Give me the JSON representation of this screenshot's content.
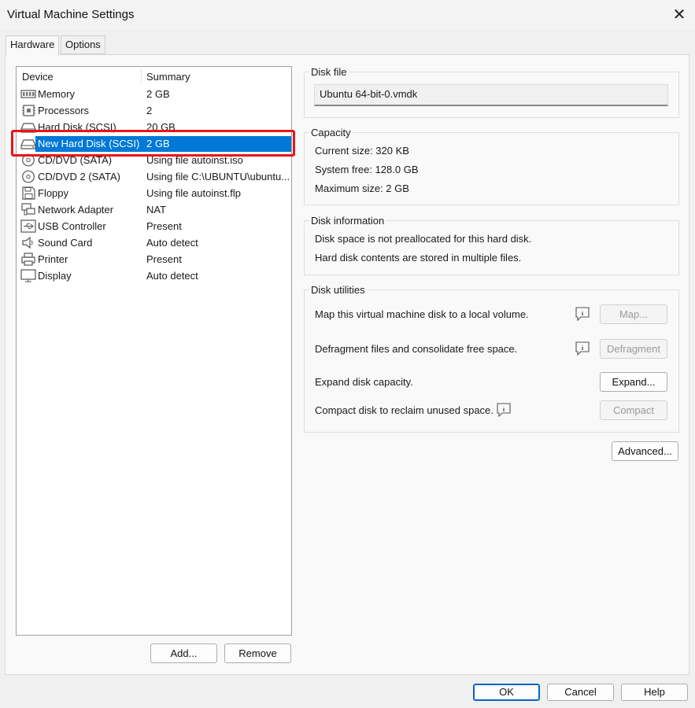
{
  "window": {
    "title": "Virtual Machine Settings",
    "close_glyph": "✕"
  },
  "tabs": [
    {
      "label": "Hardware"
    },
    {
      "label": "Options"
    }
  ],
  "devices": {
    "headers": {
      "device": "Device",
      "summary": "Summary"
    },
    "items": [
      {
        "name": "Memory",
        "summary": "2 GB",
        "icon": "memory-icon"
      },
      {
        "name": "Processors",
        "summary": "2",
        "icon": "processor-icon"
      },
      {
        "name": "Hard Disk (SCSI)",
        "summary": "20 GB",
        "icon": "hard-disk-icon"
      },
      {
        "name": "New Hard Disk (SCSI)",
        "summary": "2 GB",
        "icon": "hard-disk-icon",
        "selected": true
      },
      {
        "name": "CD/DVD (SATA)",
        "summary": "Using file autoinst.iso",
        "icon": "cd-dvd-icon"
      },
      {
        "name": "CD/DVD 2 (SATA)",
        "summary": "Using file C:\\UBUNTU\\ubuntu...",
        "icon": "cd-dvd-icon"
      },
      {
        "name": "Floppy",
        "summary": "Using file autoinst.flp",
        "icon": "floppy-icon"
      },
      {
        "name": "Network Adapter",
        "summary": "NAT",
        "icon": "network-adapter-icon"
      },
      {
        "name": "USB Controller",
        "summary": "Present",
        "icon": "usb-icon"
      },
      {
        "name": "Sound Card",
        "summary": "Auto detect",
        "icon": "speaker-icon"
      },
      {
        "name": "Printer",
        "summary": "Present",
        "icon": "printer-icon"
      },
      {
        "name": "Display",
        "summary": "Auto detect",
        "icon": "display-icon"
      }
    ],
    "add_label": "Add...",
    "remove_label": "Remove"
  },
  "disk_file": {
    "label": "Disk file",
    "value": "Ubuntu 64-bit-0.vmdk"
  },
  "capacity": {
    "label": "Capacity",
    "current": "Current size: 320 KB",
    "free": "System free: 128.0 GB",
    "maximum": "Maximum size: 2 GB"
  },
  "disk_information": {
    "label": "Disk information",
    "line1": "Disk space is not preallocated for this hard disk.",
    "line2": "Hard disk contents are stored in multiple files."
  },
  "disk_utilities": {
    "label": "Disk utilities",
    "map_text": "Map this virtual machine disk to a local volume.",
    "map_button": "Map...",
    "defrag_text": "Defragment files and consolidate free space.",
    "defrag_button": "Defragment",
    "expand_text": "Expand disk capacity.",
    "expand_button": "Expand...",
    "compact_text": "Compact disk to reclaim unused space.",
    "compact_button": "Compact"
  },
  "advanced_button": "Advanced...",
  "footer": {
    "ok": "OK",
    "cancel": "Cancel",
    "help": "Help"
  },
  "colors": {
    "selection": "#0078d7",
    "highlight_box": "#e8141b",
    "default_button_border": "#0a64c8"
  }
}
